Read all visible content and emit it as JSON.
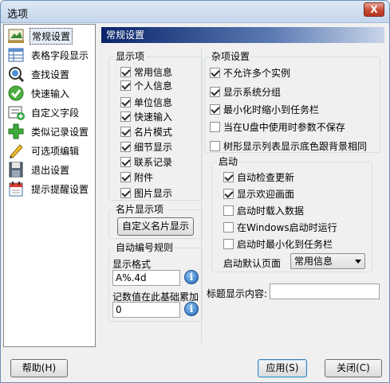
{
  "window": {
    "title": "选项",
    "close_glyph": "X"
  },
  "sidebar": {
    "items": [
      {
        "label": "常规设置",
        "icon": "general-settings-icon",
        "selected": true
      },
      {
        "label": "表格字段显示",
        "icon": "table-fields-icon"
      },
      {
        "label": "查找设置",
        "icon": "search-settings-icon"
      },
      {
        "label": "快速输入",
        "icon": "quick-input-icon"
      },
      {
        "label": "自定义字段",
        "icon": "custom-field-icon"
      },
      {
        "label": "类似记录设置",
        "icon": "similar-records-icon"
      },
      {
        "label": "可选项编辑",
        "icon": "options-edit-icon"
      },
      {
        "label": "退出设置",
        "icon": "exit-settings-icon"
      },
      {
        "label": "提示提醒设置",
        "icon": "reminder-settings-icon"
      }
    ]
  },
  "header": {
    "title": "常规设置"
  },
  "display_items": {
    "legend": "显示项",
    "items": [
      {
        "label": "常用信息",
        "checked": true
      },
      {
        "label": "个人信息",
        "checked": true
      },
      {
        "label": "单位信息",
        "checked": true
      },
      {
        "label": "快速输入",
        "checked": true
      },
      {
        "label": "名片模式",
        "checked": true
      },
      {
        "label": "细节显示",
        "checked": true
      },
      {
        "label": "联系记录",
        "checked": true
      },
      {
        "label": "附件",
        "checked": true
      },
      {
        "label": "图片显示",
        "checked": true
      }
    ]
  },
  "card_display": {
    "legend": "名片显示项",
    "button_label": "自定义名片显示"
  },
  "auto_number": {
    "legend": "自动编号规则",
    "format_label": "显示格式",
    "format_value": "A%.4d",
    "count_label": "记数值在此基础累加",
    "count_value": "0",
    "info_glyph": "i"
  },
  "misc": {
    "legend": "杂项设置",
    "items": [
      {
        "label": "不允许多个实例",
        "checked": true
      },
      {
        "label": "显示系统分组",
        "checked": true
      },
      {
        "label": "最小化时缩小到任务栏",
        "checked": true
      },
      {
        "label": "当在U盘中使用时参数不保存",
        "checked": false
      },
      {
        "label": "树形显示列表显示底色跟背景相同",
        "checked": false
      }
    ]
  },
  "startup": {
    "legend": "启动",
    "items": [
      {
        "label": "自动检查更新",
        "checked": true
      },
      {
        "label": "显示欢迎画面",
        "checked": true
      },
      {
        "label": "启动时载入数据",
        "checked": false
      },
      {
        "label": "在Windows启动时运行",
        "checked": false
      },
      {
        "label": "启动时最小化到任务栏",
        "checked": false
      }
    ],
    "default_page_label": "启动默认页面",
    "default_page_value": "常用信息"
  },
  "title_display": {
    "label": "标题显示内容:",
    "value": ""
  },
  "footer": {
    "help": "帮助(H)",
    "apply": "应用(S)",
    "close": "关闭(C)"
  }
}
